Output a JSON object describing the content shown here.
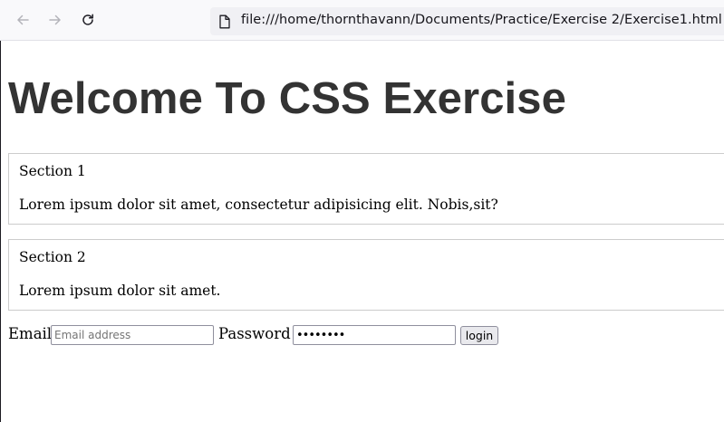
{
  "browser": {
    "url": "file:///home/thornthavann/Documents/Practice/Exercise 2/Exercise1.html",
    "icons": {
      "back": "arrow-left-icon",
      "forward": "arrow-right-icon",
      "reload": "reload-icon",
      "page": "page-icon"
    }
  },
  "page": {
    "title": "Welcome To CSS Exercise",
    "sections": [
      {
        "heading": "Section 1",
        "body": "Lorem ipsum dolor sit amet, consectetur adipisicing elit. Nobis,sit?"
      },
      {
        "heading": "Section 2",
        "body": "Lorem ipsum dolor sit amet."
      }
    ],
    "form": {
      "email_label": "Email",
      "email_placeholder": "Email address",
      "email_value": "",
      "password_label": "Password",
      "password_value": "••••••••",
      "login_label": "login"
    }
  },
  "colors": {
    "title_text": "#333333",
    "section_border": "#cccccc",
    "toolbar_bg": "#f9f9fb",
    "urlbar_bg": "#f0f0f4"
  }
}
